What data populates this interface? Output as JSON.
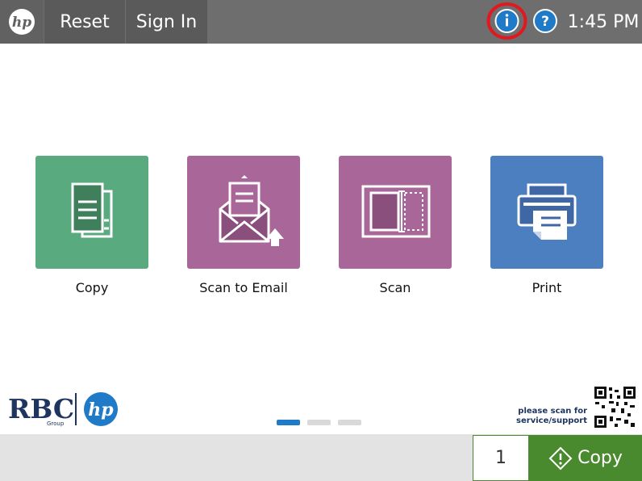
{
  "topbar": {
    "logo_icon": "hp-logo-icon",
    "reset_label": "Reset",
    "signin_label": "Sign In",
    "info_icon": "info-icon",
    "help_icon": "help-icon",
    "time": "1:45 PM",
    "background": "#6e6e6e",
    "highlight_color": "#e0181f"
  },
  "apps": [
    {
      "label": "Copy",
      "icon": "copy-icon",
      "color": "#5aaa80"
    },
    {
      "label": "Scan to Email",
      "icon": "email-icon",
      "color": "#a86798"
    },
    {
      "label": "Scan",
      "icon": "scan-icon",
      "color": "#a86798"
    },
    {
      "label": "Print",
      "icon": "printer-icon",
      "color": "#4c7fbf"
    }
  ],
  "branding": {
    "rbc_text": "RBC",
    "rbc_sub": "Group",
    "scan_line1": "please scan for",
    "scan_line2": "service/support"
  },
  "pagination": {
    "pages": 3,
    "current": 1,
    "active_color": "#1f7ac8",
    "inactive_color": "#d9d9d9"
  },
  "bottombar": {
    "copies_value": "1",
    "start_label": "Copy",
    "start_color": "#4a8a2e"
  }
}
